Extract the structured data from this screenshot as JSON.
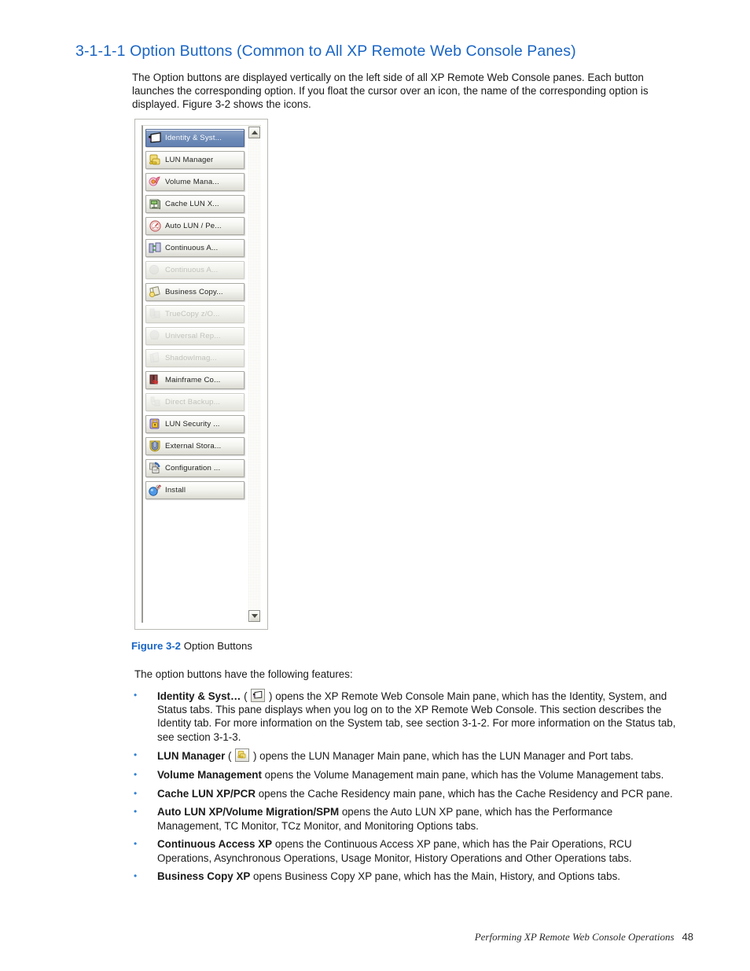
{
  "heading": "3-1-1-1 Option Buttons (Common to All XP Remote Web Console Panes)",
  "intro": "The Option buttons are displayed vertically on the left side of all XP Remote Web Console panes. Each button launches the corresponding option. If you float the cursor over an icon, the name of the corresponding option is displayed. Figure 3-2 shows the icons.",
  "figure": {
    "caption_number": "Figure 3-2",
    "caption_text": " Option Buttons",
    "scrollbar": {
      "up_arrow": "scroll-up-arrow-icon",
      "down_arrow": "scroll-down-arrow-icon"
    },
    "buttons": [
      {
        "label": "Identity & Syst...",
        "icon": "identity-system-icon",
        "state": "selected"
      },
      {
        "label": "LUN Manager",
        "icon": "lun-manager-icon",
        "state": "enabled"
      },
      {
        "label": "Volume Mana...",
        "icon": "volume-management-icon",
        "state": "enabled"
      },
      {
        "label": "Cache LUN X...",
        "icon": "cache-lun-xp-icon",
        "state": "enabled"
      },
      {
        "label": "Auto LUN / Pe...",
        "icon": "auto-lun-performance-icon",
        "state": "enabled"
      },
      {
        "label": "Continuous A...",
        "icon": "continuous-access-xp-icon",
        "state": "enabled"
      },
      {
        "label": "Continuous A...",
        "icon": "continuous-access-xp-z-icon",
        "state": "disabled"
      },
      {
        "label": "Business Copy...",
        "icon": "business-copy-xp-icon",
        "state": "enabled"
      },
      {
        "label": "TrueCopy z/O...",
        "icon": "truecopy-zos-icon",
        "state": "disabled"
      },
      {
        "label": "Universal Rep...",
        "icon": "universal-replicator-icon",
        "state": "disabled"
      },
      {
        "label": "ShadowImag...",
        "icon": "shadowimage-icon",
        "state": "disabled"
      },
      {
        "label": "Mainframe Co...",
        "icon": "mainframe-connection-icon",
        "state": "enabled"
      },
      {
        "label": "Direct Backup...",
        "icon": "direct-backup-icon",
        "state": "disabled"
      },
      {
        "label": "LUN Security ...",
        "icon": "lun-security-icon",
        "state": "enabled"
      },
      {
        "label": "External Stora...",
        "icon": "external-storage-icon",
        "state": "enabled"
      },
      {
        "label": "Configuration ...",
        "icon": "configuration-icon",
        "state": "enabled"
      },
      {
        "label": "Install",
        "icon": "install-icon",
        "state": "enabled"
      }
    ]
  },
  "features_lead": "The option buttons have the following features:",
  "bullets": [
    {
      "marker": "•",
      "term": "Identity & Syst…",
      "icon": "identity-system-icon",
      "has_icon": true,
      "text_before_paren": " ( ",
      "text": " ) opens the XP Remote Web Console Main pane, which has the Identity, System, and Status tabs. This pane displays when you log on to the XP Remote Web Console. This section describes the Identity tab. For more information on the System tab, see section 3-1-2. For more information on the Status tab, see section 3-1-3."
    },
    {
      "marker": "•",
      "term": "LUN Manager",
      "icon": "lun-manager-icon",
      "has_icon": true,
      "text_before_paren": " ( ",
      "text": " ) opens the LUN Manager Main pane, which has the LUN Manager and Port tabs."
    },
    {
      "marker": "•",
      "term": "Volume Management",
      "has_icon": false,
      "text": " opens the Volume Management main pane, which has the Volume Management tabs."
    },
    {
      "marker": "•",
      "term": "Cache LUN XP/PCR",
      "has_icon": false,
      "text": " opens the Cache Residency main pane, which has the Cache Residency and PCR pane."
    },
    {
      "marker": "•",
      "term": "Auto LUN XP/Volume Migration/SPM",
      "has_icon": false,
      "text": " opens the Auto LUN XP pane, which has the Performance Management, TC Monitor, TCz Monitor, and Monitoring Options tabs."
    },
    {
      "marker": "•",
      "term": "Continuous Access XP",
      "has_icon": false,
      "text": " opens the Continuous Access XP pane, which has the Pair Operations, RCU Operations, Asynchronous Operations, Usage Monitor, History Operations and Other Operations tabs."
    },
    {
      "marker": "•",
      "term": "Business Copy XP",
      "has_icon": false,
      "text": " opens Business Copy XP pane, which has the Main, History, and Options tabs."
    }
  ],
  "footer": {
    "text": "Performing XP Remote Web Console Operations",
    "page_number": "48"
  },
  "colors": {
    "heading_blue": "#1a65c4",
    "bullet_blue": "#2f7fd0",
    "selected_button": "#6f8cb8"
  }
}
